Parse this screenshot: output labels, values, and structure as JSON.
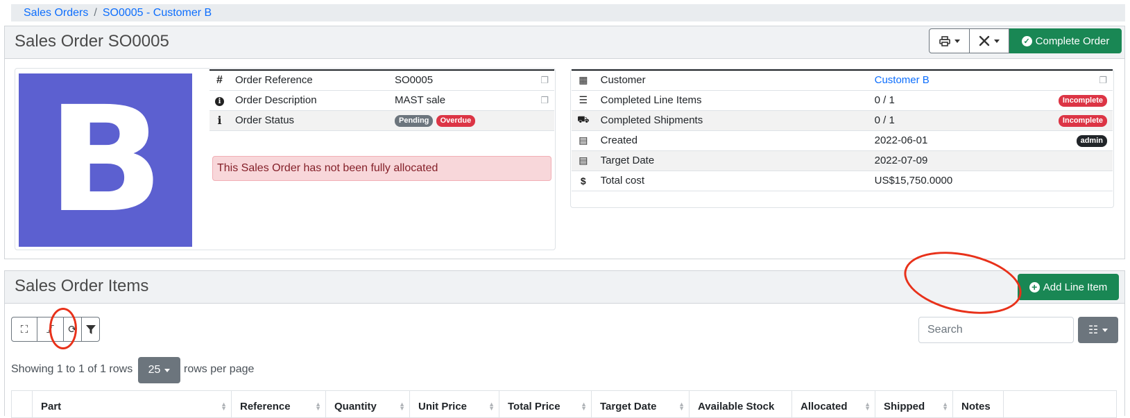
{
  "breadcrumb": [
    "Sales Orders",
    "SO0005 - Customer B"
  ],
  "order_header": {
    "title": "Sales Order SO0005",
    "complete_label": "Complete Order",
    "thumbnail_letter": "B"
  },
  "order_info": [
    {
      "icon": "#",
      "label": "Order Reference",
      "value": "SO0005"
    },
    {
      "icon": "ℹ",
      "label": "Order Description",
      "value": "MAST sale"
    },
    {
      "icon": "i",
      "label": "Order Status",
      "badges": [
        "Pending",
        "Overdue"
      ]
    }
  ],
  "alert": "This Sales Order has not been fully allocated",
  "customer_info": [
    {
      "label": "Customer",
      "value": "Customer B"
    },
    {
      "label": "Completed Line Items",
      "value": "0 / 1",
      "badge": "Incomplete"
    },
    {
      "label": "Completed Shipments",
      "value": "0 / 1",
      "badge": "Incomplete"
    },
    {
      "label": "Created",
      "value": "2022-06-01",
      "badge": "admin"
    },
    {
      "label": "Target Date",
      "value": "2022-07-09"
    },
    {
      "label": "Total cost",
      "value": "US$15,750.0000"
    }
  ],
  "items_section": {
    "title": "Sales Order Items",
    "add_label": "Add Line Item",
    "search_placeholder": "Search",
    "pagination_text": "Showing 1 to 1 of 1 rows",
    "per_page": "25",
    "per_page_suffix": "rows per page",
    "columns": [
      "Part",
      "Reference",
      "Quantity",
      "Unit Price",
      "Total Price",
      "Target Date",
      "Available Stock",
      "Allocated",
      "Shipped",
      "Notes"
    ]
  },
  "colors": {
    "success": "#198754",
    "danger": "#dc3545",
    "link": "#0d6efd",
    "thumbnail_bg": "#5c60d0",
    "annotation": "#e8311a"
  }
}
